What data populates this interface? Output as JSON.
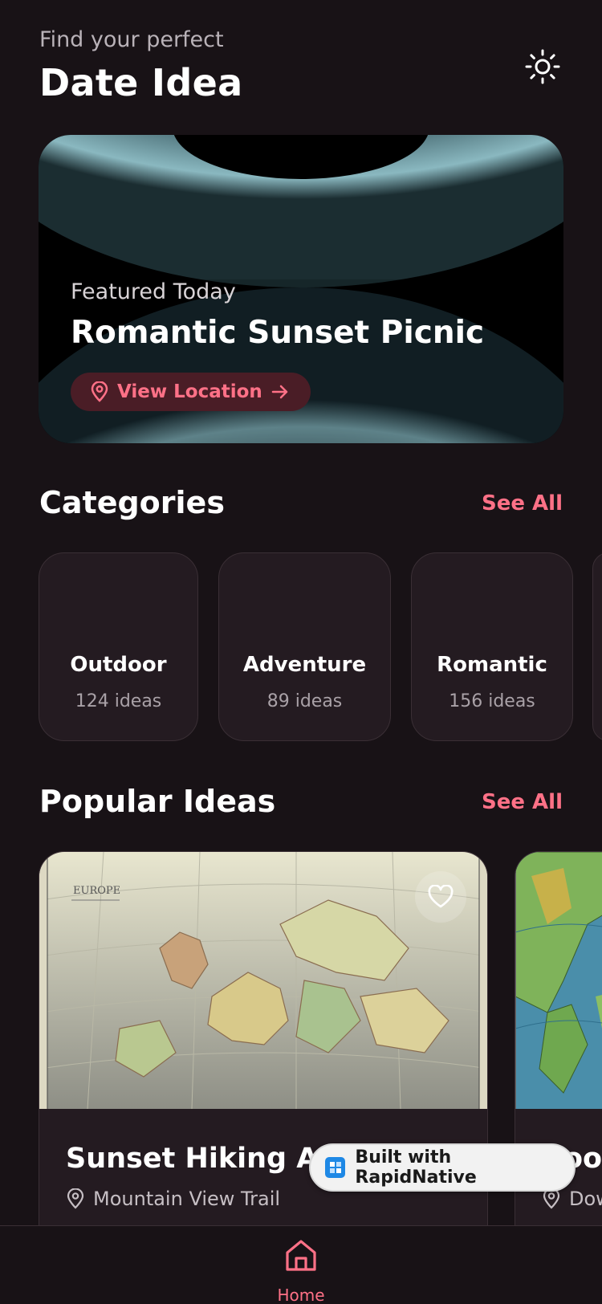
{
  "header": {
    "subtitle": "Find your perfect",
    "title": "Date Idea",
    "theme_icon": "sun-icon"
  },
  "featured": {
    "label": "Featured Today",
    "title": "Romantic Sunset Picnic",
    "button_label": "View Location"
  },
  "categories": {
    "title": "Categories",
    "see_all": "See All",
    "items": [
      {
        "name": "Outdoor",
        "count": "124 ideas"
      },
      {
        "name": "Adventure",
        "count": "89 ideas"
      },
      {
        "name": "Romantic",
        "count": "156 ideas"
      }
    ]
  },
  "popular": {
    "title": "Popular Ideas",
    "see_all": "See All",
    "items": [
      {
        "title": "Sunset Hiking Adv",
        "location": "Mountain View Trail",
        "image": "europe-map",
        "map_label": "EUROPE"
      },
      {
        "title": "Roof",
        "location": "Dow",
        "image": "southeast-asia-map"
      }
    ]
  },
  "badge": {
    "label": "Built with RapidNative"
  },
  "tabbar": {
    "home_label": "Home"
  },
  "colors": {
    "background": "#181216",
    "accent": "#ff7187",
    "card": "#241b21"
  }
}
